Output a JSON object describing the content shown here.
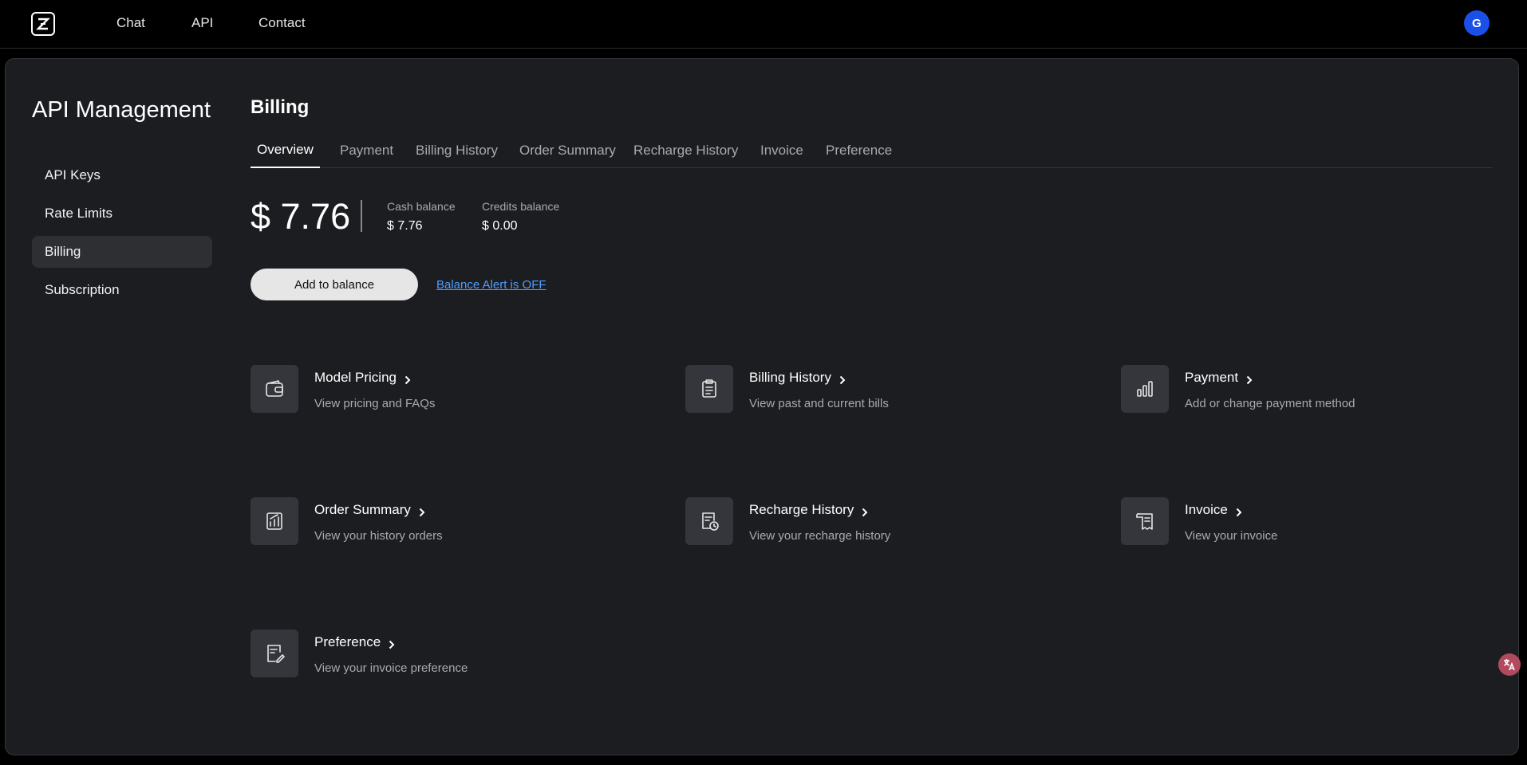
{
  "nav": {
    "links": [
      "Chat",
      "API",
      "Contact"
    ],
    "avatar_initial": "G"
  },
  "sidebar": {
    "title": "API Management",
    "items": [
      {
        "label": "API Keys",
        "active": false
      },
      {
        "label": "Rate Limits",
        "active": false
      },
      {
        "label": "Billing",
        "active": true
      },
      {
        "label": "Subscription",
        "active": false
      }
    ]
  },
  "billing": {
    "title": "Billing",
    "tabs": [
      "Overview",
      "Payment",
      "Billing History",
      "Order Summary",
      "Recharge History",
      "Invoice",
      "Preference"
    ],
    "active_tab": "Overview",
    "total_balance": "$ 7.76",
    "cash_balance_label": "Cash balance",
    "cash_balance_value": "$ 7.76",
    "credits_balance_label": "Credits balance",
    "credits_balance_value": "$ 0.00",
    "add_button_label": "Add to balance",
    "alert_link_label": "Balance Alert is OFF"
  },
  "cards": [
    {
      "title": "Model Pricing",
      "desc": "View pricing and FAQs",
      "icon": "wallet-icon"
    },
    {
      "title": "Billing History",
      "desc": "View past and current bills",
      "icon": "clipboard-icon"
    },
    {
      "title": "Payment",
      "desc": "Add or change payment method",
      "icon": "bar-chart-icon"
    },
    {
      "title": "Order Summary",
      "desc": "View your history orders",
      "icon": "report-icon"
    },
    {
      "title": "Recharge History",
      "desc": "View your recharge history",
      "icon": "document-clock-icon"
    },
    {
      "title": "Invoice",
      "desc": "View your invoice",
      "icon": "receipt-icon"
    },
    {
      "title": "Preference",
      "desc": "View your invoice preference",
      "icon": "document-edit-icon"
    }
  ],
  "colors": {
    "background": "#000000",
    "panel": "#1c1d20",
    "accent_link": "#4f9cff",
    "avatar": "#1a4fe8"
  }
}
